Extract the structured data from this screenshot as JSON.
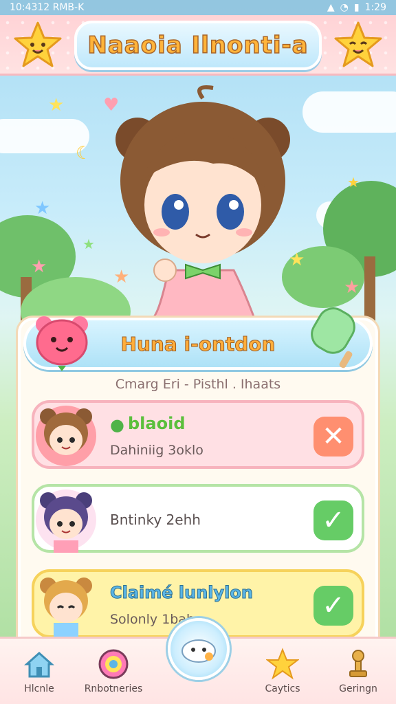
{
  "status_bar": {
    "left": "10:4312 RMB-K",
    "right": "1:29"
  },
  "header": {
    "title": "Naaoia Ilnonti-a"
  },
  "panel": {
    "title": "Huna i-ontdon",
    "subtitle": "Cmarg   Eri - Pisthl . Ihaats"
  },
  "items": [
    {
      "title": "blaoid",
      "subtitle": "Dahiniig 3oklo",
      "action": "decline",
      "bg": "#ffe0e4",
      "border": "#f7b3bd"
    },
    {
      "title": "",
      "subtitle": "Bntinky 2ehh",
      "action": "accept",
      "bg": "#ffffff",
      "border": "#b5e4a6"
    },
    {
      "title": "Claimé lunlylon",
      "subtitle": "Solonly 1bah",
      "action": "accept",
      "bg": "#fff3a8",
      "border": "#f6d25b"
    }
  ],
  "nav": [
    {
      "label": "Hlcnle",
      "icon": "home-icon"
    },
    {
      "label": "Rnbotneries",
      "icon": "orb-icon"
    },
    {
      "label": "",
      "icon": "pet-face-icon"
    },
    {
      "label": "Caytics",
      "icon": "star-icon"
    },
    {
      "label": "Geringn",
      "icon": "trophy-icon"
    }
  ],
  "colors": {
    "accent": "#ffb43a",
    "sky": "#a9dcf4",
    "pink": "#ffd3d6"
  }
}
